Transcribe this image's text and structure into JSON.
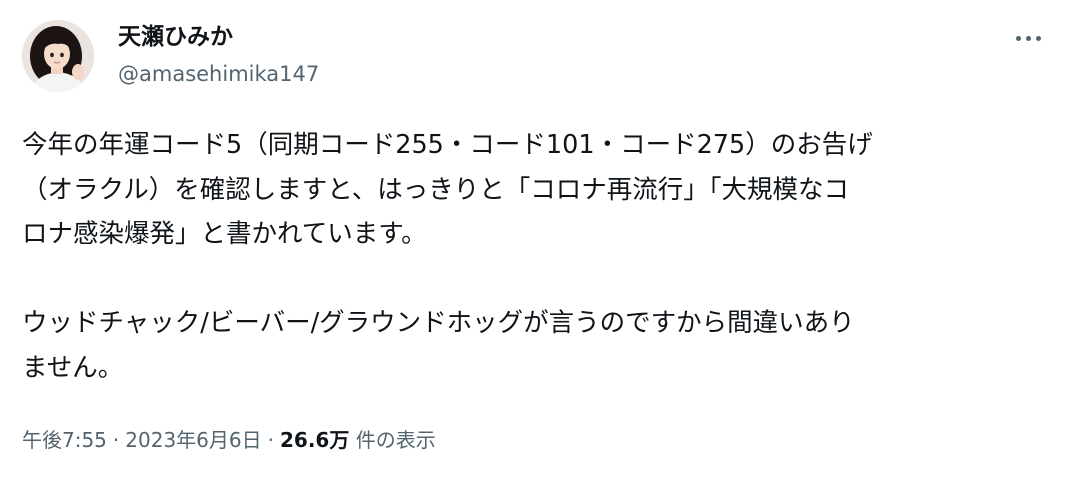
{
  "author": {
    "display_name": "天瀬ひみか",
    "handle": "@amasehimika147"
  },
  "tweet": {
    "lines": [
      "今年の年運コード5（同期コード255・コード101・コード275）のお告げ",
      "（オラクル）を確認しますと、はっきりと「コロナ再流行」「大規模なコ",
      "ロナ感染爆発」と書かれています。",
      "",
      "ウッドチャック/ビーバー/グラウンドホッグが言うのですから間違いあり",
      "ません。"
    ]
  },
  "meta": {
    "time": "午後7:55",
    "separator": "·",
    "date": "2023年6月6日",
    "views_count": "26.6万",
    "views_label": "件の表示"
  },
  "icons": {
    "more": "more-horizontal-icon"
  },
  "colors": {
    "text_primary": "#0f1419",
    "text_secondary": "#536471",
    "background": "#ffffff"
  }
}
